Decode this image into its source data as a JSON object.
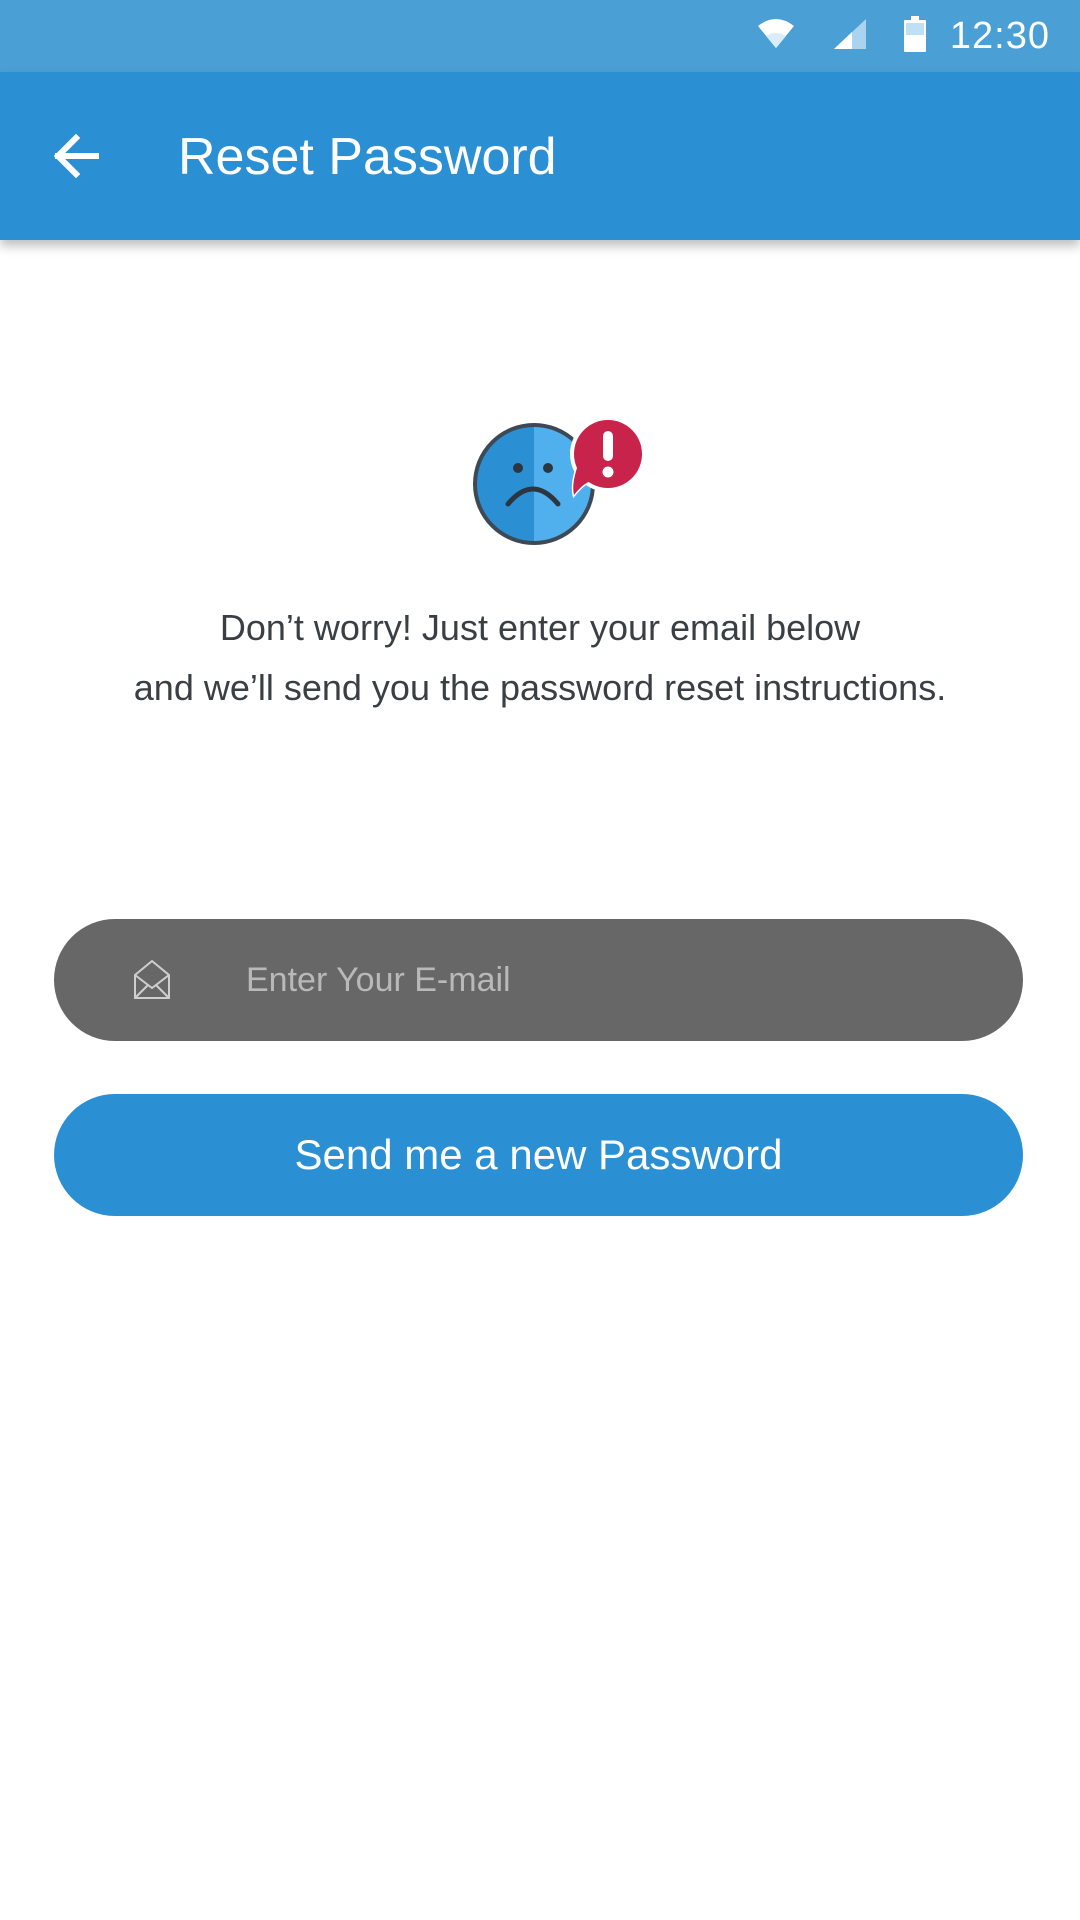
{
  "status_bar": {
    "time": "12:30",
    "icons": [
      "wifi-icon",
      "cell-signal-icon",
      "battery-icon"
    ]
  },
  "app_bar": {
    "back_icon": "arrow-left-icon",
    "title": "Reset Password"
  },
  "illustration": {
    "icon": "sad-face-alert-icon"
  },
  "message": {
    "line1": "Don’t worry! Just enter your email below",
    "line2": "and we’ll send you the password reset instructions."
  },
  "email_field": {
    "icon": "envelope-icon",
    "value": "",
    "placeholder": "Enter Your E-mail"
  },
  "send_button": {
    "label": "Send me a new Password"
  },
  "colors": {
    "status_bar": "#4aa0d5",
    "primary": "#2b8fd4",
    "input_bg": "#676767",
    "alert": "#c8234a",
    "text": "#3a3f44"
  }
}
